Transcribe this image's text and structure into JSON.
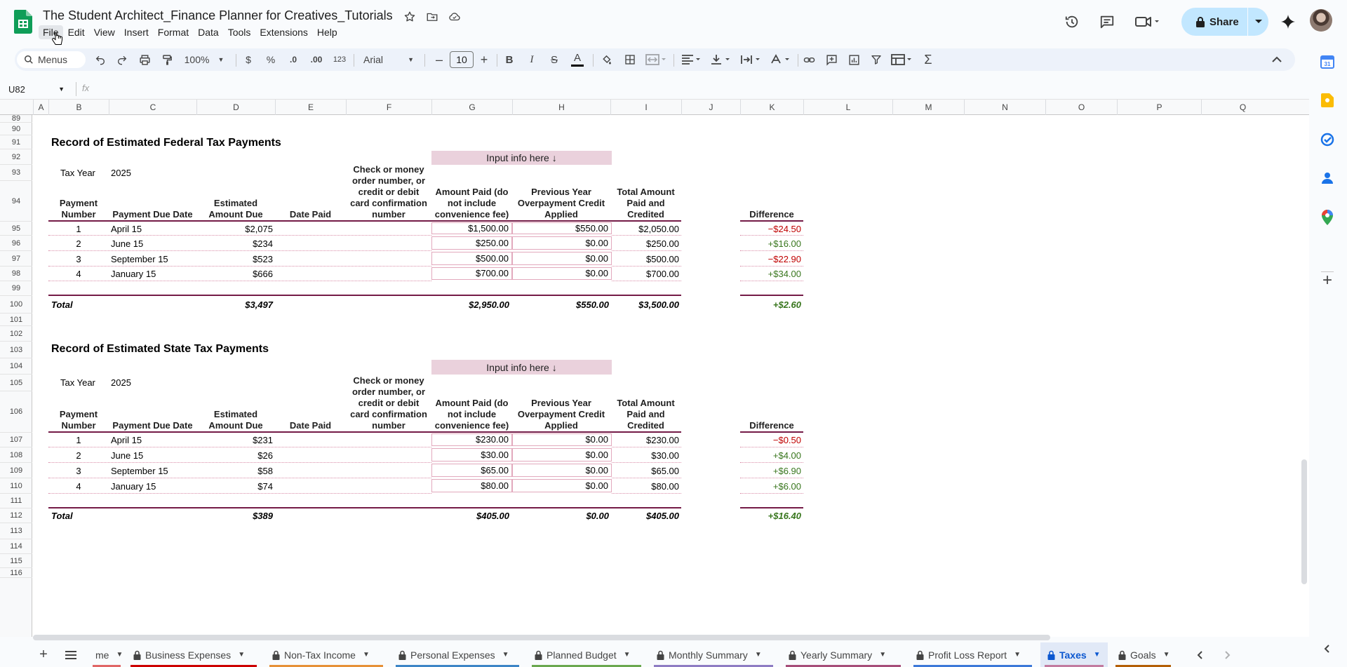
{
  "doc_title": "The Student Architect_Finance Planner for Creatives_Tutorials",
  "menu": [
    "File",
    "Edit",
    "View",
    "Insert",
    "Format",
    "Data",
    "Tools",
    "Extensions",
    "Help"
  ],
  "share_label": "Share",
  "toolbar": {
    "menus_label": "Menus",
    "zoom": "100%",
    "currency": "$",
    "percent": "%",
    "dec_decrease": ".0",
    "dec_increase": ".00",
    "number_format": "123",
    "font": "Arial",
    "font_size": "10"
  },
  "name_box": "U82",
  "fx_label": "fx",
  "columns": [
    "A",
    "B",
    "C",
    "D",
    "E",
    "F",
    "G",
    "H",
    "I",
    "J",
    "K",
    "L",
    "M",
    "N",
    "O",
    "P",
    "Q"
  ],
  "rows": [
    "89",
    "90",
    "91",
    "92",
    "93",
    "94",
    "95",
    "96",
    "97",
    "98",
    "99",
    "100",
    "101",
    "102",
    "103",
    "104",
    "105",
    "106",
    "107",
    "108",
    "109",
    "110",
    "111",
    "112",
    "113",
    "114",
    "115",
    "116"
  ],
  "federal": {
    "title": "Record of Estimated Federal Tax Payments",
    "input_note": "Input info here ↓",
    "tax_year_label": "Tax Year",
    "tax_year": "2025",
    "headers": {
      "payment_number": "Payment Number",
      "due_date": "Payment Due Date",
      "estimated": "Estimated Amount Due",
      "date_paid": "Date Paid",
      "confirmation": "Check or money order number, or credit or debit card confirmation number",
      "amount_paid": "Amount Paid (do not include convenience fee)",
      "overpayment": "Previous Year Overpayment Credit Applied",
      "total": "Total Amount Paid and Credited",
      "difference": "Difference"
    },
    "rows": [
      {
        "num": "1",
        "date": "April 15",
        "est": "$2,075",
        "paid": "$1,500.00",
        "over": "$550.00",
        "total": "$2,050.00",
        "diff": "−$24.50"
      },
      {
        "num": "2",
        "date": "June 15",
        "est": "$234",
        "paid": "$250.00",
        "over": "$0.00",
        "total": "$250.00",
        "diff": "+$16.00"
      },
      {
        "num": "3",
        "date": "September 15",
        "est": "$523",
        "paid": "$500.00",
        "over": "$0.00",
        "total": "$500.00",
        "diff": "−$22.90"
      },
      {
        "num": "4",
        "date": "January 15",
        "est": "$666",
        "paid": "$700.00",
        "over": "$0.00",
        "total": "$700.00",
        "diff": "+$34.00"
      }
    ],
    "totals": {
      "label": "Total",
      "est": "$3,497",
      "paid": "$2,950.00",
      "over": "$550.00",
      "total": "$3,500.00",
      "diff": "+$2.60"
    }
  },
  "state": {
    "title": "Record of Estimated State Tax Payments",
    "input_note": "Input info here ↓",
    "tax_year_label": "Tax Year",
    "tax_year": "2025",
    "headers": {
      "payment_number": "Payment Number",
      "due_date": "Payment Due Date",
      "estimated": "Estimated Amount Due",
      "date_paid": "Date Paid",
      "confirmation": "Check or money order number, or credit or debit card confirmation number",
      "amount_paid": "Amount Paid (do not include convenience fee)",
      "overpayment": "Previous Year Overpayment Credit Applied",
      "total": "Total Amount Paid and Credited",
      "difference": "Difference"
    },
    "rows": [
      {
        "num": "1",
        "date": "April 15",
        "est": "$231",
        "paid": "$230.00",
        "over": "$0.00",
        "total": "$230.00",
        "diff": "−$0.50"
      },
      {
        "num": "2",
        "date": "June 15",
        "est": "$26",
        "paid": "$30.00",
        "over": "$0.00",
        "total": "$30.00",
        "diff": "+$4.00"
      },
      {
        "num": "3",
        "date": "September 15",
        "est": "$58",
        "paid": "$65.00",
        "over": "$0.00",
        "total": "$65.00",
        "diff": "+$6.90"
      },
      {
        "num": "4",
        "date": "January 15",
        "est": "$74",
        "paid": "$80.00",
        "over": "$0.00",
        "total": "$80.00",
        "diff": "+$6.00"
      }
    ],
    "totals": {
      "label": "Total",
      "est": "$389",
      "paid": "$405.00",
      "over": "$0.00",
      "total": "$405.00",
      "diff": "+$16.40"
    }
  },
  "tabs": [
    {
      "label": "me",
      "locked": false,
      "color": "#e06666"
    },
    {
      "label": "Business Expenses",
      "locked": true,
      "color": "#cc0000"
    },
    {
      "label": "Non-Tax Income",
      "locked": true,
      "color": "#e69138"
    },
    {
      "label": "Personal Expenses",
      "locked": true,
      "color": "#3d85c6"
    },
    {
      "label": "Planned Budget",
      "locked": true,
      "color": "#6aa84f"
    },
    {
      "label": "Monthly Summary",
      "locked": true,
      "color": "#8e7cc3"
    },
    {
      "label": "Yearly Summary",
      "locked": true,
      "color": "#a64d79"
    },
    {
      "label": "Profit Loss Report",
      "locked": true,
      "color": "#3c78d8"
    },
    {
      "label": "Taxes",
      "locked": true,
      "color": "#c27ba0",
      "active": true
    },
    {
      "label": "Goals",
      "locked": true,
      "color": "#b45f06"
    }
  ],
  "colors": {
    "accent": "#0b57d0",
    "header_rule": "#741b47",
    "input_fill": "#ead1dc",
    "negative": "#c00000",
    "positive": "#38761d"
  }
}
